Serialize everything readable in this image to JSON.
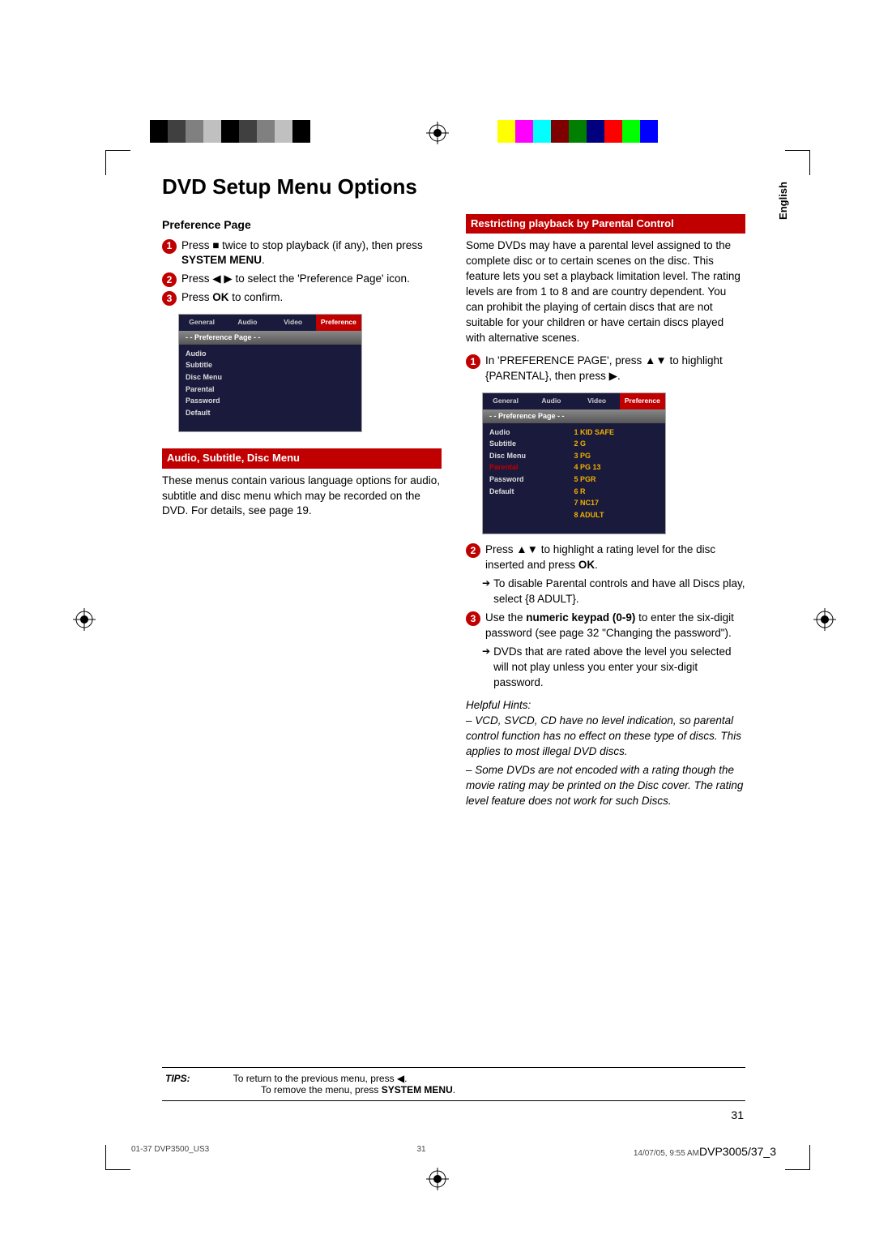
{
  "title": "DVD Setup Menu Options",
  "side_tab": "English",
  "left": {
    "heading": "Preference Page",
    "step1_a": "Press ",
    "step1_b": " twice to stop playback (if any), then press ",
    "step1_c": "SYSTEM MENU",
    "step1_d": ".",
    "step2_a": "Press ",
    "step2_b": " to select the 'Preference Page' icon.",
    "step3_a": "Press ",
    "step3_b": "OK",
    "step3_c": " to confirm.",
    "banner": "Audio, Subtitle, Disc Menu",
    "para": "These menus contain various language options for audio, subtitle and disc menu which may be recorded on the DVD.  For details, see page 19."
  },
  "menu1": {
    "tabs": [
      "General",
      "Audio",
      "Video",
      "Preference"
    ],
    "header": "- -   Preference Page   - -",
    "items": [
      "Audio",
      "Subtitle",
      "Disc Menu",
      "Parental",
      "Password",
      "Default"
    ]
  },
  "right": {
    "banner": "Restricting playback by Parental Control",
    "para1": "Some DVDs may have a parental level assigned to the complete disc or to certain scenes on the disc.  This feature lets you set a playback limitation level. The rating levels are from 1 to 8 and are country dependent.  You can prohibit the playing of certain discs that are not suitable for your children or have certain discs played with alternative scenes.",
    "step1_a": "In 'PREFERENCE PAGE', press ",
    "step1_b": " to highlight {PARENTAL}, then press ",
    "step1_c": ".",
    "step2_a": "Press ",
    "step2_b": " to highlight a rating level for the disc inserted and press ",
    "step2_c": "OK",
    "step2_d": ".",
    "note2": "To disable Parental controls and have all Discs play, select {8 ADULT}.",
    "step3_a": "Use the ",
    "step3_b": "numeric keypad (0-9)",
    "step3_c": " to enter the six-digit password (see page 32 \"Changing the password\").",
    "note3": "DVDs that are rated above the level you selected will not play unless you enter your six-digit password.",
    "hints_label": "Helpful Hints:",
    "hint1": "–   VCD, SVCD, CD have no level indication, so parental control function has no effect on these type of discs. This applies to most illegal DVD discs.",
    "hint2": "–   Some DVDs are not encoded with a rating though the movie rating may be printed on the Disc cover.  The rating level feature does not work for such Discs."
  },
  "menu2": {
    "tabs": [
      "General",
      "Audio",
      "Video",
      "Preference"
    ],
    "header": "- -   Preference Page   - -",
    "items": [
      "Audio",
      "Subtitle",
      "Disc Menu",
      "Parental",
      "Password",
      "Default"
    ],
    "values": [
      "1 KID SAFE",
      "2 G",
      "3 PG",
      "4 PG 13",
      "5 PGR",
      "6 R",
      "7 NC17",
      "8 ADULT"
    ]
  },
  "tips": {
    "label": "TIPS:",
    "line1_a": "To return to the previous menu, press ",
    "line1_b": ".",
    "line2_a": "To remove the menu, press ",
    "line2_b": "SYSTEM MENU",
    "line2_c": "."
  },
  "page_number": "31",
  "footer": {
    "left": "01-37 DVP3500_US3",
    "center": "31",
    "right_time": "14/07/05, 9:55 AM",
    "right_model": "DVP3005/37_3"
  },
  "colorbar_left": [
    "#000",
    "#404040",
    "#808080",
    "#c0c0c0",
    "#000",
    "#404040",
    "#808080",
    "#c0c0c0",
    "#000",
    "#fff"
  ],
  "colorbar_right": [
    "#ffff00",
    "#ff00ff",
    "#00ffff",
    "#7f0000",
    "#007f00",
    "#00007f",
    "#ff0000",
    "#00ff00",
    "#0000ff"
  ],
  "glyphs": {
    "stop": "■",
    "leftright": "◀ ▶",
    "updown": "▲▼",
    "right": "▶",
    "left": "◀"
  }
}
